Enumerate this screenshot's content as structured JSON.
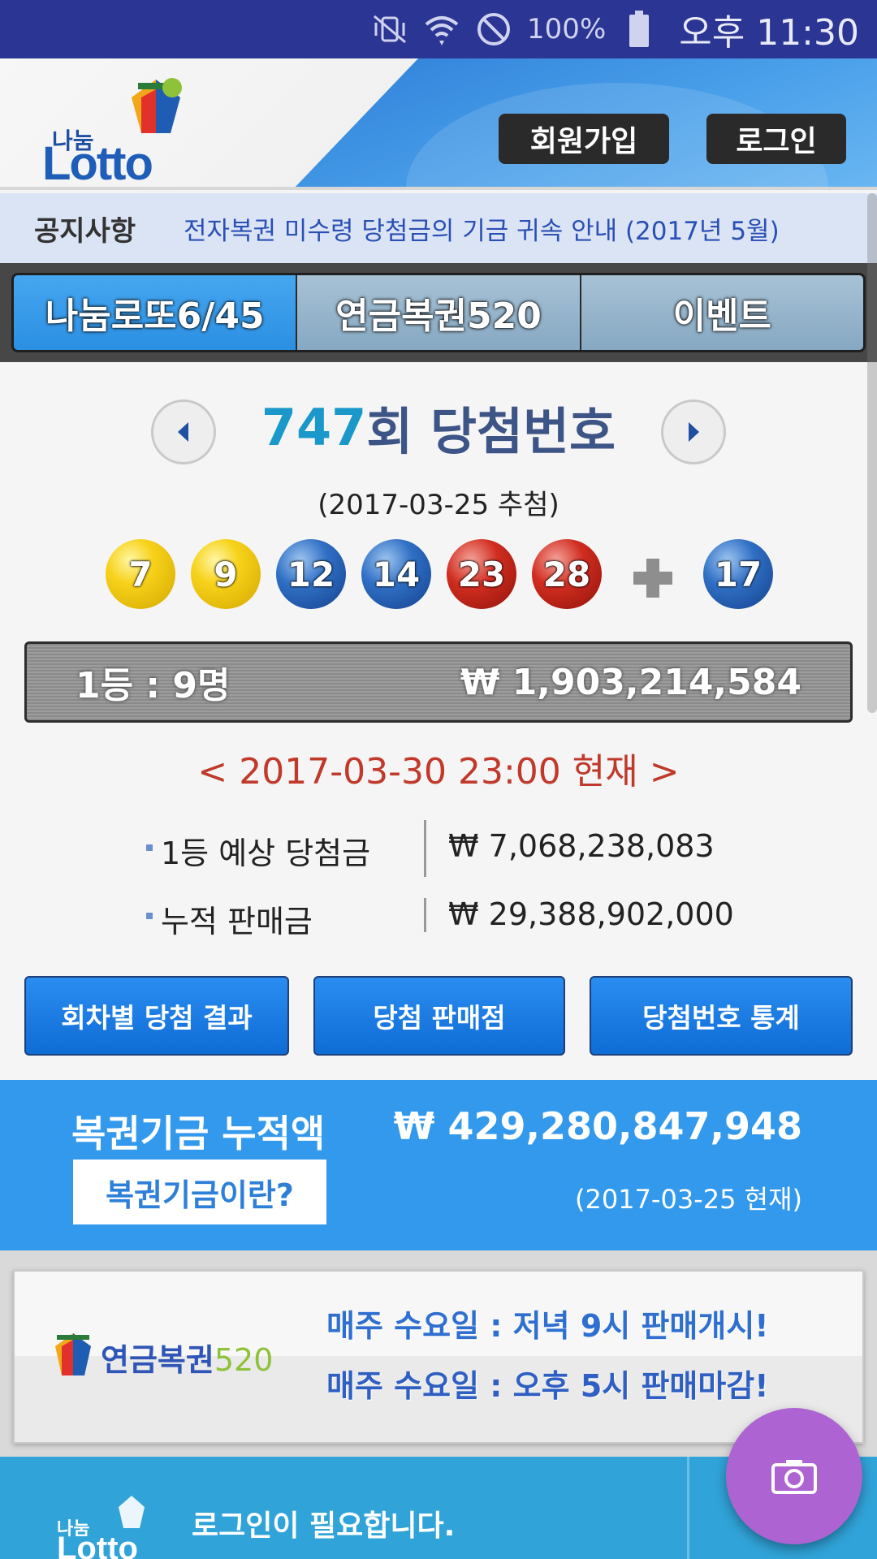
{
  "status_bar": {
    "icons": [
      "vibrate-mute-icon",
      "wifi-icon",
      "do-not-disturb-icon",
      "battery-icon"
    ],
    "battery": "100%",
    "time": "오후 11:30"
  },
  "header": {
    "logo_small": "나눔",
    "logo_big": "Lotto",
    "join_label": "회원가입",
    "login_label": "로그인"
  },
  "notice": {
    "label": "공지사항",
    "text": "전자복권 미수령 당첨금의 기금 귀속 안내 (2017년 5월)"
  },
  "tabs": [
    {
      "label": "나눔로또6/45",
      "active": true
    },
    {
      "label": "연금복권520",
      "active": false
    },
    {
      "label": "이벤트",
      "active": false
    }
  ],
  "draw": {
    "round": "747",
    "round_suffix": "회 당첨번호",
    "date": "(2017-03-25 추첨)",
    "numbers": [
      {
        "n": "7",
        "color": "yellow"
      },
      {
        "n": "9",
        "color": "yellow"
      },
      {
        "n": "12",
        "color": "blue"
      },
      {
        "n": "14",
        "color": "blue"
      },
      {
        "n": "23",
        "color": "red"
      },
      {
        "n": "28",
        "color": "red"
      }
    ],
    "bonus": {
      "n": "17",
      "color": "blue"
    },
    "first_prize_winners": "1등 : 9명",
    "first_prize_amount": "₩ 1,903,214,584",
    "as_of": "< 2017-03-30 23:00 현재 >"
  },
  "stats": [
    {
      "label": "1등 예상 당첨금",
      "value": "₩ 7,068,238,083"
    },
    {
      "label": "누적 판매금",
      "value": "₩ 29,388,902,000"
    }
  ],
  "actions": [
    {
      "label": "회차별 당첨 결과"
    },
    {
      "label": "당첨 판매점"
    },
    {
      "label": "당첨번호 통계"
    }
  ],
  "fund": {
    "title": "복권기금 누적액",
    "button": "복권기금이란?",
    "amount": "₩ 429,280,847,948",
    "date": "(2017-03-25 현재)"
  },
  "ad": {
    "brand": "연금복권",
    "brand_num": "520",
    "line1": "매주 수요일 : 저녁 9시 판매개시!",
    "line2": "매주 수요일 : 오후 5시 판매마감!"
  },
  "bottom": {
    "logo_small": "나눔",
    "logo_big": "Lotto",
    "text": "로그인이 필요합니다."
  },
  "colors": {
    "status_bar": "#2b3593",
    "accent_blue": "#3399ec",
    "round_number": "#1a98c9",
    "as_of_red": "#c0392b",
    "fab": "#ad64d2"
  }
}
